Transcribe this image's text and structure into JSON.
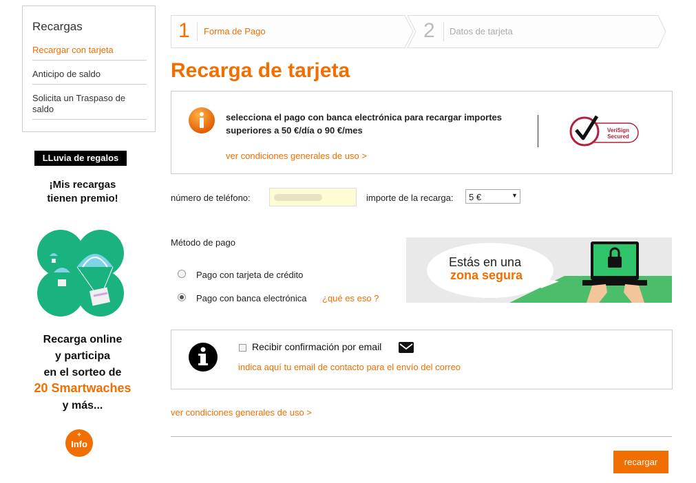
{
  "sidebar": {
    "title": "Recargas",
    "items": [
      {
        "label": "Recargar con tarjeta"
      },
      {
        "label": "Anticipo de saldo"
      },
      {
        "label": "Solicita un Traspaso de saldo"
      }
    ]
  },
  "promo": {
    "badge": "LLuvia de regalos",
    "headline_1": "¡Mis recargas",
    "headline_2": "tienen premio!",
    "text_1": "Recarga online",
    "text_2": "y participa",
    "text_3": "en el sorteo de",
    "highlight": "20 Smartwaches",
    "text_4": "y más...",
    "info_button": "Info",
    "info_plus": "+"
  },
  "steps": [
    {
      "num": "1",
      "label": "Forma de Pago"
    },
    {
      "num": "2",
      "label": "Datos de tarjeta"
    }
  ],
  "page_title": "Recarga de tarjeta",
  "info": {
    "message_1": "selecciona el pago con banca electrónica para recargar importes",
    "message_2": "superiores a 50 €/día o 90 €/mes",
    "link": "ver condiciones generales de uso >",
    "verisign_1": "VeriSign",
    "verisign_2": "Secured"
  },
  "form": {
    "phone_label": "número de teléfono:",
    "phone_value": "",
    "amount_label": "importe de la recarga:",
    "amount_value": "5 €"
  },
  "payment": {
    "title": "Método de pago",
    "option_card": "Pago con tarjeta de crédito",
    "option_bank": "Pago con banca electrónica",
    "whats_this": "¿qué es eso ?",
    "selected": "bank"
  },
  "secure_banner": {
    "line_1": "Estás en una",
    "line_2": "zona segura"
  },
  "email": {
    "checkbox_label": "Recibir confirmación por email",
    "hint": "indica aquí tu email de contacto para el envío del correo",
    "checked": false
  },
  "footer_link": "ver condiciones generales de uso >",
  "submit_label": "recargar",
  "colors": {
    "accent": "#f16e00",
    "green": "#1ab27e",
    "secure_green": "#4cbd6a"
  }
}
